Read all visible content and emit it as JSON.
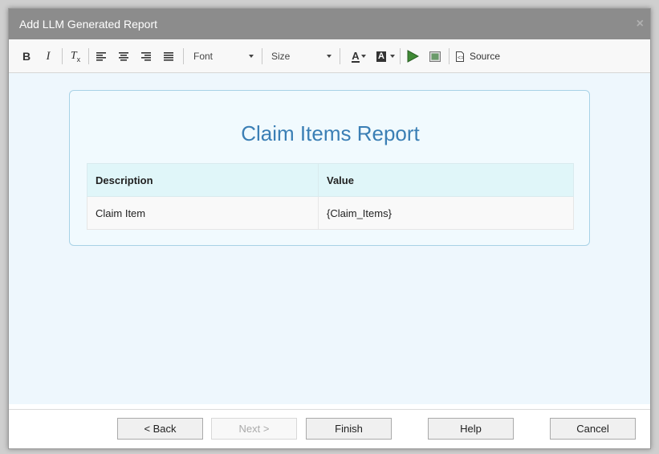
{
  "dialog": {
    "title": "Add LLM Generated Report",
    "close_glyph": "×"
  },
  "toolbar": {
    "bold": "B",
    "italic": "I",
    "clear_format": "T",
    "clear_format_sub": "x",
    "font_label": "Font",
    "size_label": "Size",
    "text_color_glyph": "A",
    "bg_color_glyph": "A",
    "source_label": "Source",
    "icons": [
      "bold-icon",
      "italic-icon",
      "remove-format-icon",
      "align-left-icon",
      "align-center-icon",
      "align-right-icon",
      "align-justify-icon",
      "text-color-icon",
      "background-color-icon",
      "play-icon",
      "image-icon",
      "source-icon"
    ]
  },
  "report": {
    "title": "Claim Items Report",
    "headers": [
      "Description",
      "Value"
    ],
    "rows": [
      [
        "Claim Item",
        "{Claim_Items}"
      ]
    ]
  },
  "footer": {
    "back": "< Back",
    "next": "Next >",
    "finish": "Finish",
    "help": "Help",
    "cancel": "Cancel"
  }
}
